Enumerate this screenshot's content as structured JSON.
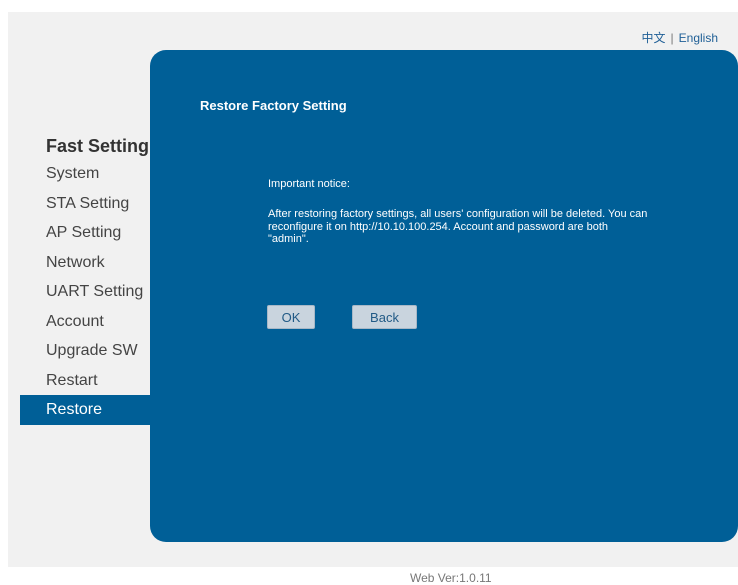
{
  "language": {
    "chinese": "中文",
    "separator": "|",
    "english": "English"
  },
  "nav": {
    "title": "Fast Setting",
    "items": [
      {
        "label": "System"
      },
      {
        "label": "STA Setting"
      },
      {
        "label": "AP Setting"
      },
      {
        "label": "Network"
      },
      {
        "label": "UART Setting"
      },
      {
        "label": "Account"
      },
      {
        "label": "Upgrade SW"
      },
      {
        "label": "Restart"
      },
      {
        "label": "Restore",
        "active": true
      }
    ]
  },
  "panel": {
    "title": "Restore Factory Setting",
    "notice_title": "Important notice:",
    "notice_body": "After restoring factory settings, all users' configuration will be deleted. You can reconfigure it on http://10.10.100.254. Account and password are both \"admin\".",
    "ok_label": "OK",
    "back_label": "Back"
  },
  "footer": {
    "version": "Web Ver:1.0.11"
  },
  "colors": {
    "accent": "#005f97",
    "background": "#f1f1f1",
    "button": "#c9d4de"
  }
}
